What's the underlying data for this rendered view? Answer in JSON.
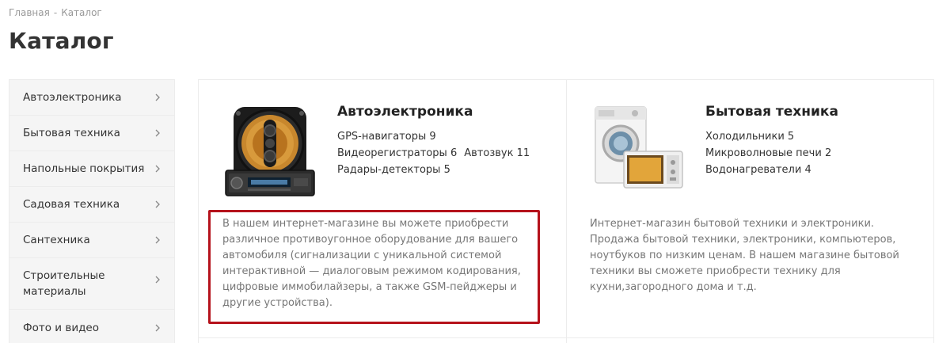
{
  "breadcrumb": {
    "home": "Главная",
    "separator": "-",
    "current": "Каталог"
  },
  "page_title": "Каталог",
  "sidebar": {
    "items": [
      {
        "label": "Автоэлектроника"
      },
      {
        "label": "Бытовая техника"
      },
      {
        "label": "Напольные покрытия"
      },
      {
        "label": "Садовая техника"
      },
      {
        "label": "Сантехника"
      },
      {
        "label": "Строительные материалы"
      },
      {
        "label": "Фото и видео"
      }
    ]
  },
  "cards": [
    {
      "title": "Автоэлектроника",
      "subcategories": [
        {
          "name": "GPS-навигаторы",
          "count": "9"
        },
        {
          "name": "Видеорегистраторы",
          "count": "6"
        },
        {
          "name": "Автозвук",
          "count": "11"
        },
        {
          "name": "Радары-детекторы",
          "count": "5"
        }
      ],
      "description": "В нашем интернет-магазине вы можете приобрести различное противоугонное оборудование для вашего автомобиля (сигнализации с уникальной системой интерактивной — диалоговым режимом кодирования, цифровые иммобилайзеры, а также GSM-пейджеры и другие устройства).",
      "image_icon": "car-speaker-radio-icon"
    },
    {
      "title": "Бытовая техника",
      "subcategories": [
        {
          "name": "Холодильники",
          "count": "5"
        },
        {
          "name": "Микроволновые печи",
          "count": "2"
        },
        {
          "name": "Водонагреватели",
          "count": "4"
        }
      ],
      "description": "Интернет-магазин бытовой техники и электроники. Продажа бытовой техники, электроники, компьютеров, ноутбуков по низким ценам. В нашем магазине бытовой техники вы сможете приобрести технику для кухни,загородного дома и т.д.",
      "image_icon": "washer-microwave-icon"
    }
  ],
  "colors": {
    "highlight_border": "#b5121b",
    "sidebar_bg": "#f5f5f5",
    "border": "#ececec",
    "description_text": "#777777"
  }
}
